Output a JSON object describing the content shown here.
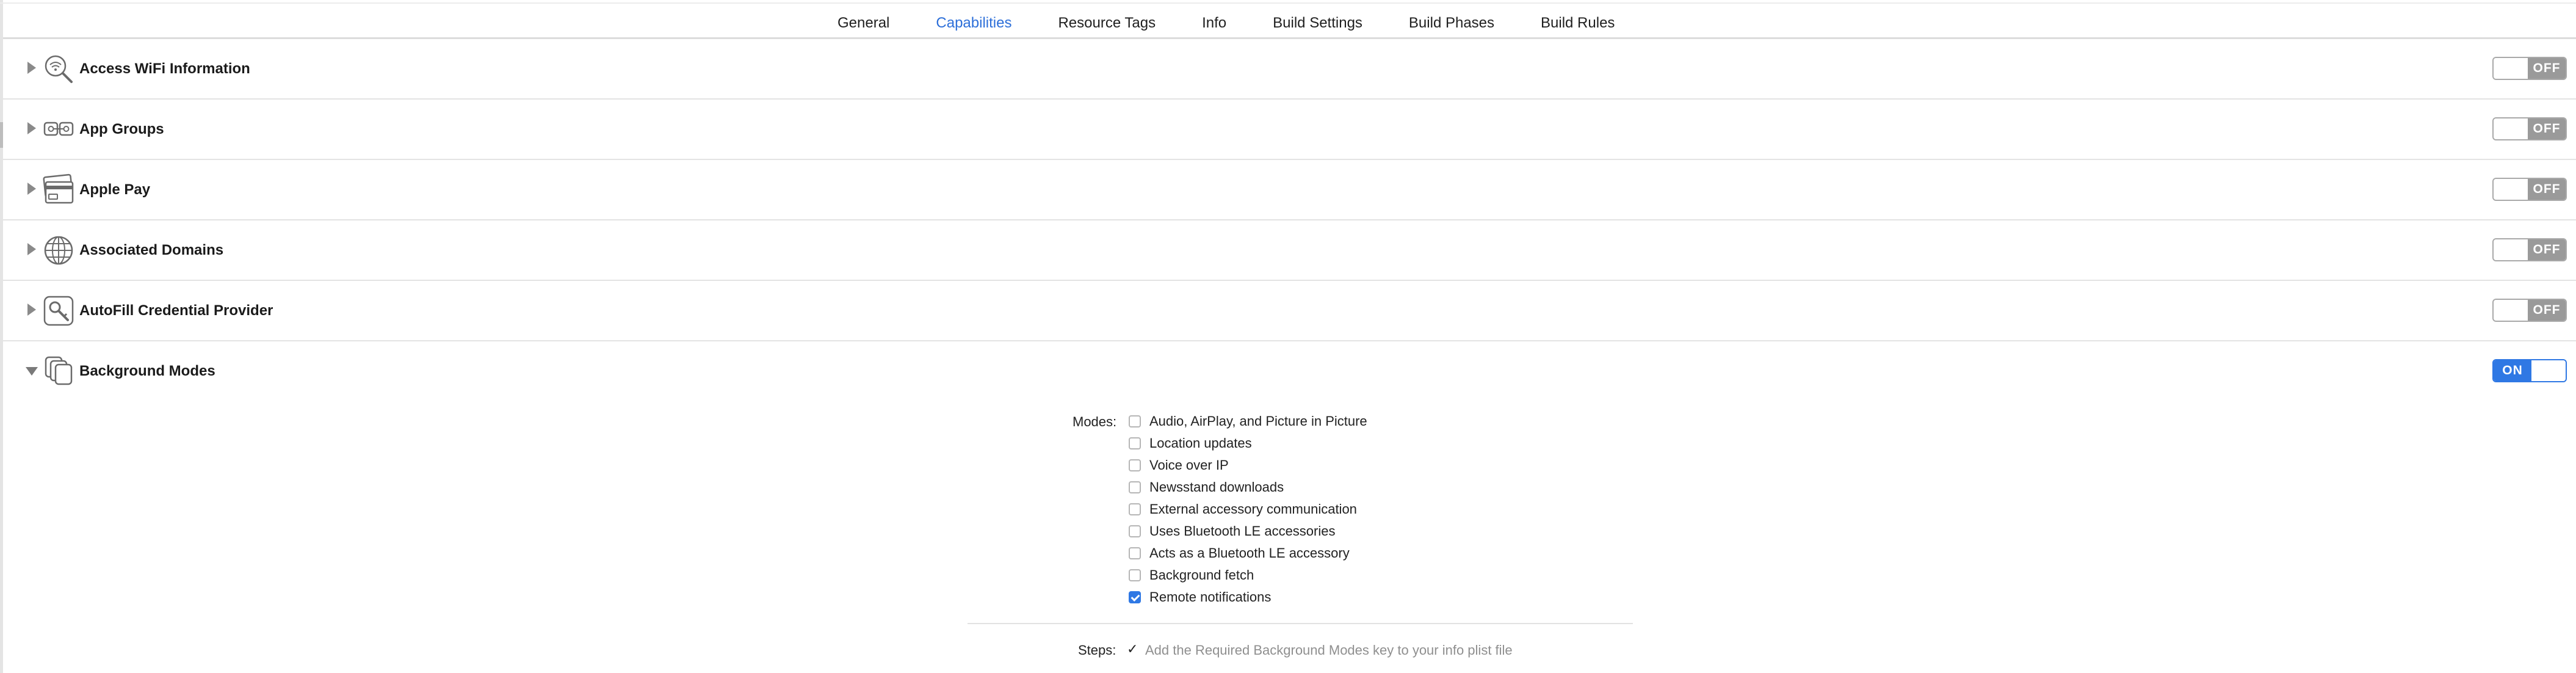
{
  "tabs": [
    {
      "label": "General",
      "active": false
    },
    {
      "label": "Capabilities",
      "active": true
    },
    {
      "label": "Resource Tags",
      "active": false
    },
    {
      "label": "Info",
      "active": false
    },
    {
      "label": "Build Settings",
      "active": false
    },
    {
      "label": "Build Phases",
      "active": false
    },
    {
      "label": "Build Rules",
      "active": false
    }
  ],
  "capabilities": [
    {
      "title": "Access WiFi Information",
      "icon": "wifi-search-icon",
      "state": "OFF",
      "expanded": false
    },
    {
      "title": "App Groups",
      "icon": "app-groups-icon",
      "state": "OFF",
      "expanded": false
    },
    {
      "title": "Apple Pay",
      "icon": "credit-card-icon",
      "state": "OFF",
      "expanded": false
    },
    {
      "title": "Associated Domains",
      "icon": "globe-icon",
      "state": "OFF",
      "expanded": false
    },
    {
      "title": "AutoFill Credential Provider",
      "icon": "key-icon",
      "state": "OFF",
      "expanded": false
    },
    {
      "title": "Background Modes",
      "icon": "background-modes-icon",
      "state": "ON",
      "expanded": true
    }
  ],
  "background_modes": {
    "modes_label": "Modes:",
    "items": [
      {
        "label": "Audio, AirPlay, and Picture in Picture",
        "checked": false
      },
      {
        "label": "Location updates",
        "checked": false
      },
      {
        "label": "Voice over IP",
        "checked": false
      },
      {
        "label": "Newsstand downloads",
        "checked": false
      },
      {
        "label": "External accessory communication",
        "checked": false
      },
      {
        "label": "Uses Bluetooth LE accessories",
        "checked": false
      },
      {
        "label": "Acts as a Bluetooth LE accessory",
        "checked": false
      },
      {
        "label": "Background fetch",
        "checked": false
      },
      {
        "label": "Remote notifications",
        "checked": true
      }
    ],
    "steps_label": "Steps:",
    "steps_check": "✓",
    "steps_text": "Add the Required Background Modes key to your info plist file"
  },
  "colors": {
    "accent": "#2f78e4",
    "toggle_off": "#9a9a9a",
    "active_tab": "#2d6fd9"
  }
}
